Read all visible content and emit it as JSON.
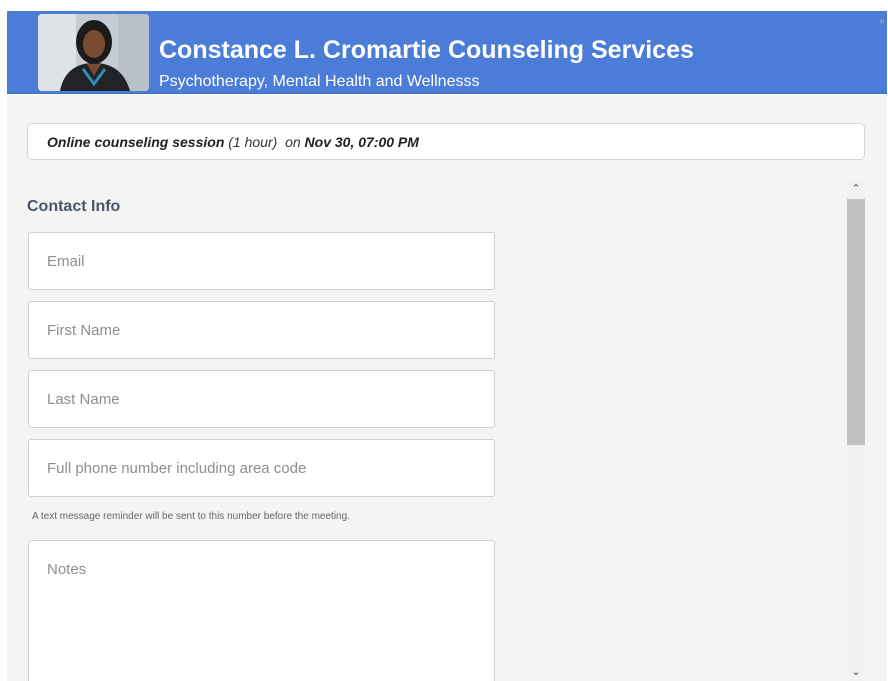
{
  "header": {
    "title": "Constance L. Cromartie Counseling Services",
    "subtitle": "Psychotherapy, Mental Health and Wellnesss",
    "close_glyph": "×"
  },
  "session": {
    "name": "Online counseling session",
    "duration": "(1 hour)",
    "on_word": "on",
    "datetime": "Nov 30, 07:00 PM"
  },
  "contact": {
    "section_title": "Contact Info",
    "email_placeholder": "Email",
    "first_name_placeholder": "First Name",
    "last_name_placeholder": "Last Name",
    "phone_placeholder": "Full phone number including area code",
    "phone_hint": "A text message reminder will be sent to this number before the meeting.",
    "notes_placeholder": "Notes"
  },
  "scrollbar": {
    "up_glyph": "⌃",
    "down_glyph": "⌄"
  },
  "colors": {
    "header_bg": "#4a7cd8",
    "panel_bg": "#f4f4f4"
  }
}
